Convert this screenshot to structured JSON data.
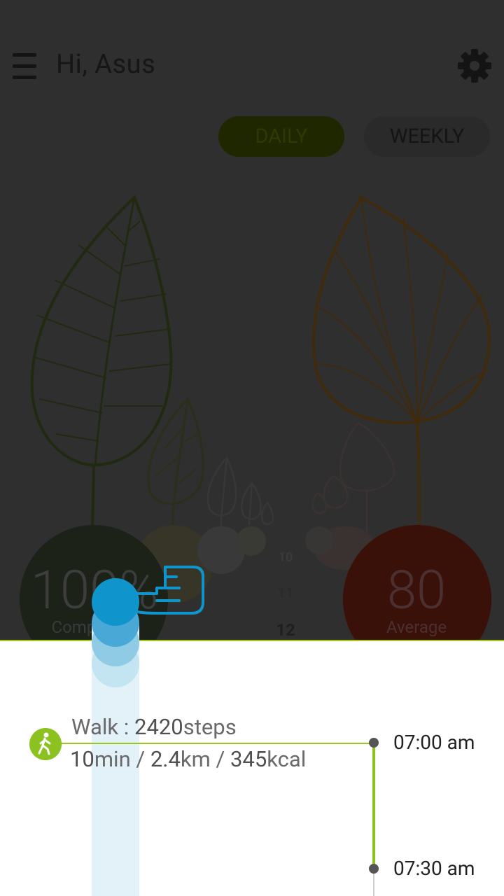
{
  "header": {
    "greeting": "Hi, Asus",
    "menu_icon": "hamburger-menu-icon",
    "settings_icon": "gear-icon"
  },
  "tabs": [
    {
      "label": "DAILY",
      "selected": true
    },
    {
      "label": "WEEKLY",
      "selected": false
    }
  ],
  "summary": {
    "completion_value": "100%",
    "completion_label": "Completion",
    "average_value": "80",
    "average_label": "Average"
  },
  "hour_ticks": [
    "10",
    "11",
    "12"
  ],
  "activity": {
    "type_label": "Walk : ",
    "steps_value": "2420",
    "steps_unit": "steps",
    "duration_value": "10",
    "duration_unit": "min / ",
    "distance_value": "2.4",
    "distance_unit": "km / ",
    "calories_value": "345",
    "calories_unit": "kcal",
    "icon": "walking-person-icon"
  },
  "timeline": {
    "start_time": "07:00 am",
    "end_time": "07:30 am"
  },
  "tutorial": {
    "gesture_icon": "pointing-hand-icon"
  },
  "colors": {
    "accent_green": "#8cc220",
    "touch_blue": "#0f95cc",
    "overlay_dark": "#2f2f2f",
    "average_red": "#3a1108"
  }
}
